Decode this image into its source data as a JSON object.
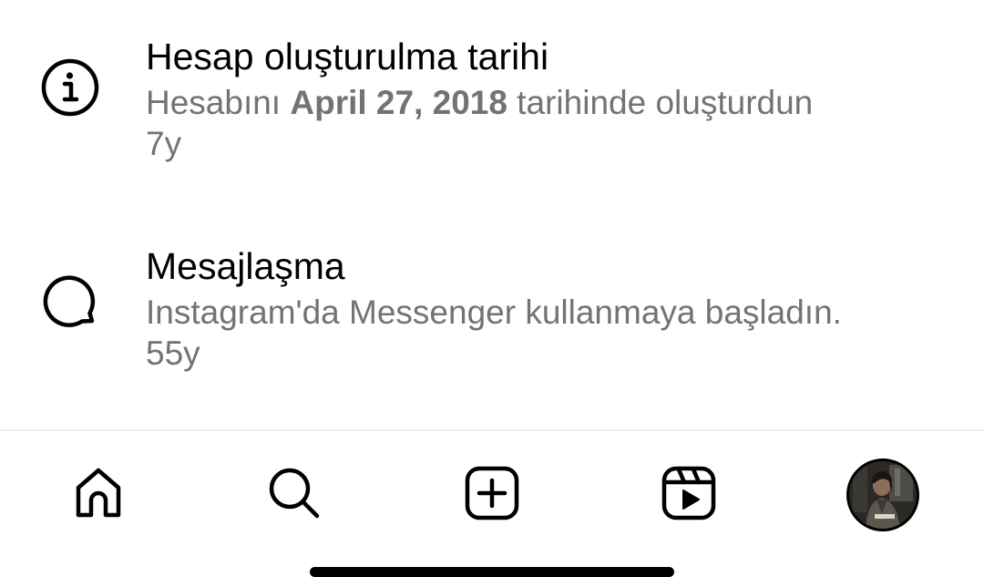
{
  "items": [
    {
      "icon": "info-icon",
      "title": "Hesap oluşturulma tarihi",
      "desc_before": "Hesabını",
      "desc_bold": "April 27, 2018",
      "desc_after": "tarihinde oluşturdun",
      "age": "7y"
    },
    {
      "icon": "chat-bubble-icon",
      "title": "Mesajlaşma",
      "desc": "Instagram'da Messenger kullanmaya başladın.",
      "age": "55y"
    }
  ],
  "tabbar": {
    "tabs": [
      {
        "icon": "home-icon"
      },
      {
        "icon": "search-icon"
      },
      {
        "icon": "create-post-icon"
      },
      {
        "icon": "reels-icon"
      },
      {
        "icon": "profile-avatar"
      }
    ]
  },
  "colors": {
    "primary_text": "#000000",
    "secondary_text": "#737373",
    "divider": "#efefef",
    "background": "#ffffff"
  }
}
